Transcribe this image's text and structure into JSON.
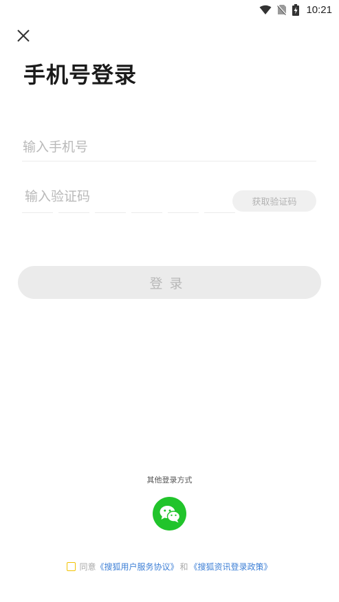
{
  "status_bar": {
    "time": "10:21",
    "icons": [
      "wifi-icon",
      "no-sim-icon",
      "battery-charging-icon"
    ]
  },
  "header": {
    "close_icon": "close-icon",
    "title": "手机号登录"
  },
  "form": {
    "phone_placeholder": "输入手机号",
    "phone_value": "",
    "code_placeholder": "输入验证码",
    "code_value": "",
    "get_code_label": "获取验证码",
    "login_label": "登录"
  },
  "other_login": {
    "label": "其他登录方式",
    "wechat_icon": "wechat-icon"
  },
  "agreement": {
    "checked": false,
    "prefix": "同意",
    "user_agreement": "《搜狐用户服务协议》",
    "and": "和",
    "privacy_policy": "《搜狐资讯登录政策》"
  },
  "colors": {
    "wechat_green": "#21c42b",
    "link_blue": "#3d7fd6",
    "checkbox_yellow": "#f2c200",
    "disabled_button_bg": "#ebebeb",
    "disabled_button_text": "#b7b7b7"
  }
}
